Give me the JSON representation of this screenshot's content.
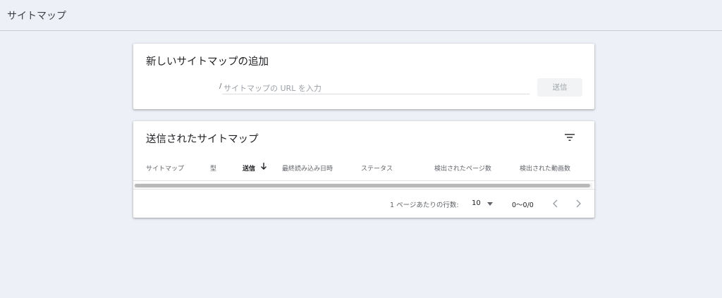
{
  "header": {
    "title": "サイトマップ"
  },
  "add_card": {
    "title": "新しいサイトマップの追加",
    "url_prefix": "/",
    "url_placeholder": "サイトマップの URL を入力",
    "url_value": "",
    "submit_label": "送信"
  },
  "submitted_card": {
    "title": "送信されたサイトマップ",
    "filter_icon": "filter-icon",
    "columns": [
      {
        "label": "サイトマップ"
      },
      {
        "label": "型"
      },
      {
        "label": "送信",
        "sorted": "descending"
      },
      {
        "label": "最終読み込み日時"
      },
      {
        "label": "ステータス"
      },
      {
        "label": "検出されたページ数"
      },
      {
        "label": "検出された動画数"
      }
    ],
    "rows": [],
    "pagination": {
      "rows_per_page_label": "1 ページあたりの行数:",
      "rows_per_page": "10",
      "range": "0〜0/0",
      "prev_icon": "chevron-left-icon",
      "next_icon": "chevron-right-icon"
    }
  },
  "colors": {
    "background": "#eef0f7",
    "card": "#ffffff",
    "disabled_button": "#f1f3f4"
  }
}
